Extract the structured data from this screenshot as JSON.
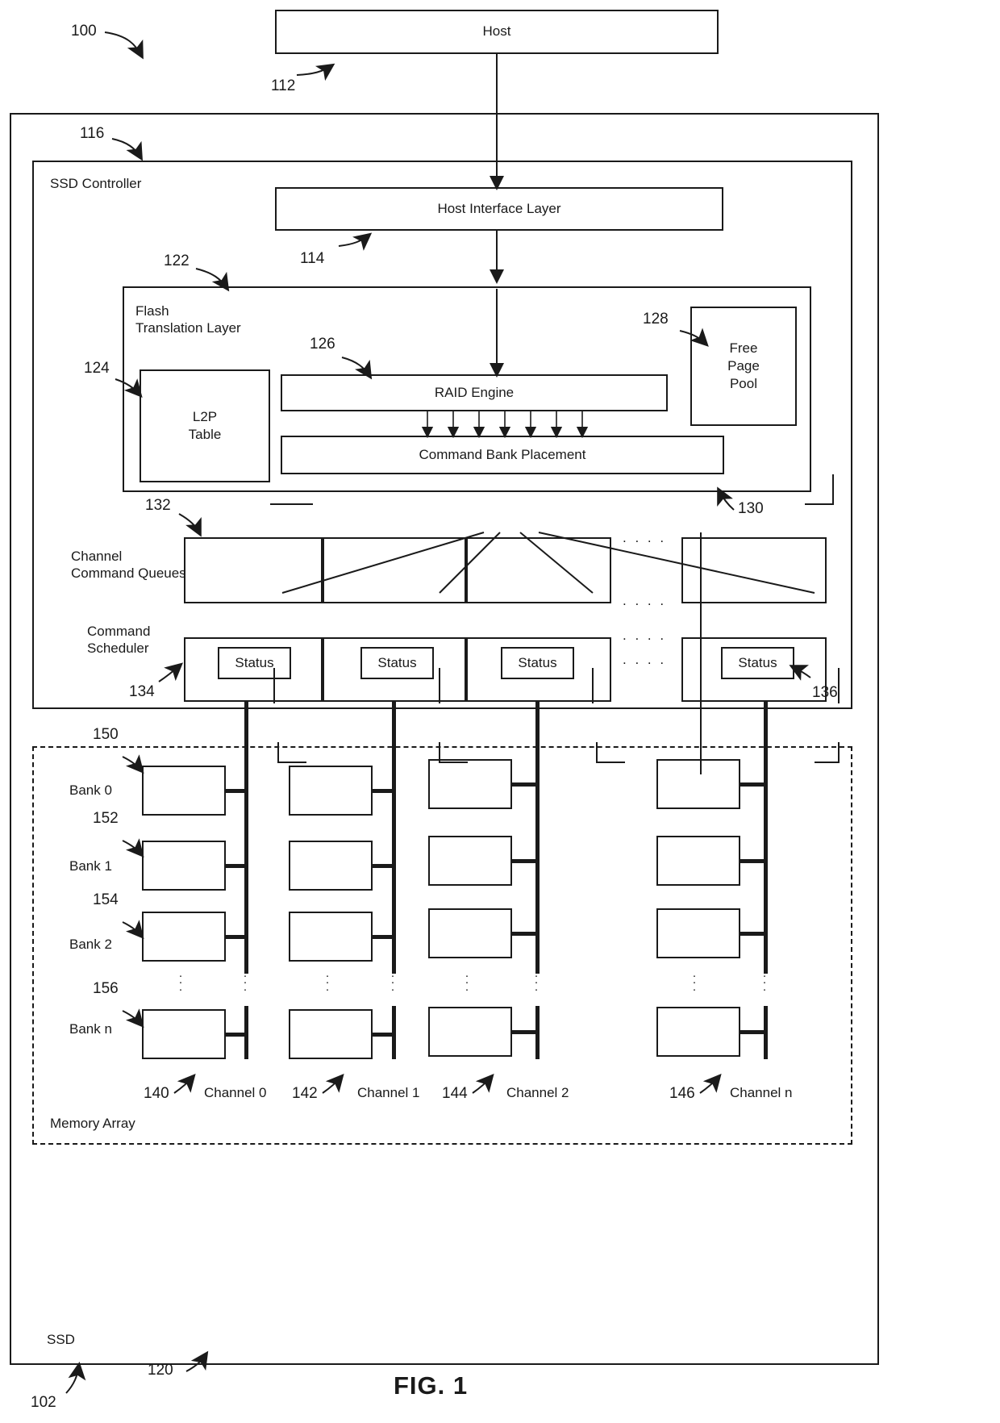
{
  "figure": {
    "title": "FIG. 1",
    "refs": {
      "system": "100",
      "ssd": "102",
      "host": "112",
      "host_interface_layer": "114",
      "ssd_controller": "116",
      "memory_array": "120",
      "flash_translation_layer": "122",
      "l2p_table": "124",
      "raid_engine": "126",
      "free_page_pool": "128",
      "command_bank_placement": "130",
      "channel_command_queues": "132",
      "command_scheduler": "134",
      "status": "136",
      "channel_0": "140",
      "channel_1": "142",
      "channel_2": "144",
      "channel_n": "146",
      "bank_0": "150",
      "bank_1": "152",
      "bank_2": "154",
      "bank_n": "156"
    }
  },
  "blocks": {
    "host": "Host",
    "ssd": "SSD",
    "ssd_controller": "SSD Controller",
    "host_interface_layer": "Host Interface Layer",
    "flash_translation_layer": "Flash\nTranslation Layer",
    "l2p_table": "L2P\nTable",
    "raid_engine": "RAID Engine",
    "free_page_pool": "Free\nPage\nPool",
    "command_bank_placement": "Command Bank Placement",
    "channel_command_queues": "Channel\nCommand Queues",
    "command_scheduler": "Command\nScheduler",
    "memory_array": "Memory Array",
    "status": "Status"
  },
  "banks": [
    {
      "label": "Bank 0",
      "ref": "150"
    },
    {
      "label": "Bank 1",
      "ref": "152"
    },
    {
      "label": "Bank 2",
      "ref": "154"
    },
    {
      "label": "Bank n",
      "ref": "156"
    }
  ],
  "channels": [
    {
      "label": "Channel 0",
      "ref": "140"
    },
    {
      "label": "Channel 1",
      "ref": "142"
    },
    {
      "label": "Channel 2",
      "ref": "144"
    },
    {
      "label": "Channel n",
      "ref": "146"
    }
  ],
  "status_cells": [
    "Status",
    "Status",
    "Status",
    "Status"
  ],
  "ellipsis": {
    "horizontal": ". . . .",
    "vertical": "·\n·\n·"
  },
  "colors": {
    "ink": "#1a1a1a",
    "background": "#ffffff"
  }
}
